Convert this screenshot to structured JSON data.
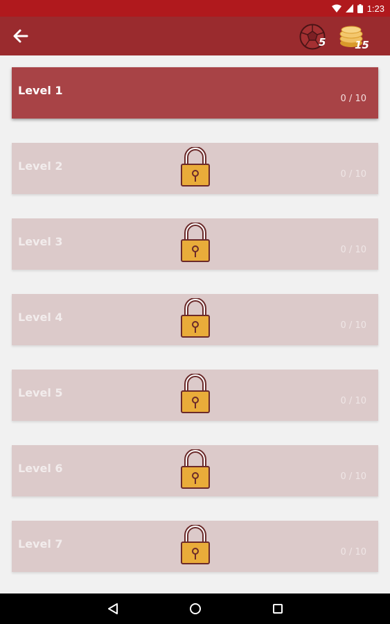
{
  "status_bar": {
    "time": "1:23"
  },
  "header": {
    "back_icon": "back-arrow-icon",
    "balls_count": "5",
    "coins_count": "15"
  },
  "levels": [
    {
      "name": "Level 1",
      "progress": "0 / 10",
      "locked": false
    },
    {
      "name": "Level 2",
      "progress": "0 / 10",
      "locked": true
    },
    {
      "name": "Level 3",
      "progress": "0 / 10",
      "locked": true
    },
    {
      "name": "Level 4",
      "progress": "0 / 10",
      "locked": true
    },
    {
      "name": "Level 5",
      "progress": "0 / 10",
      "locked": true
    },
    {
      "name": "Level 6",
      "progress": "0 / 10",
      "locked": true
    },
    {
      "name": "Level 7",
      "progress": "0 / 10",
      "locked": true
    }
  ],
  "colors": {
    "status_bar": "#b0191d",
    "app_bar": "#9a2b2e",
    "active_level": "#a84346",
    "locked_level": "#dccaca",
    "lock": "#e9ac3a"
  },
  "nav_bar": {
    "icons": [
      "back-triangle-icon",
      "home-circle-icon",
      "recents-square-icon"
    ]
  }
}
